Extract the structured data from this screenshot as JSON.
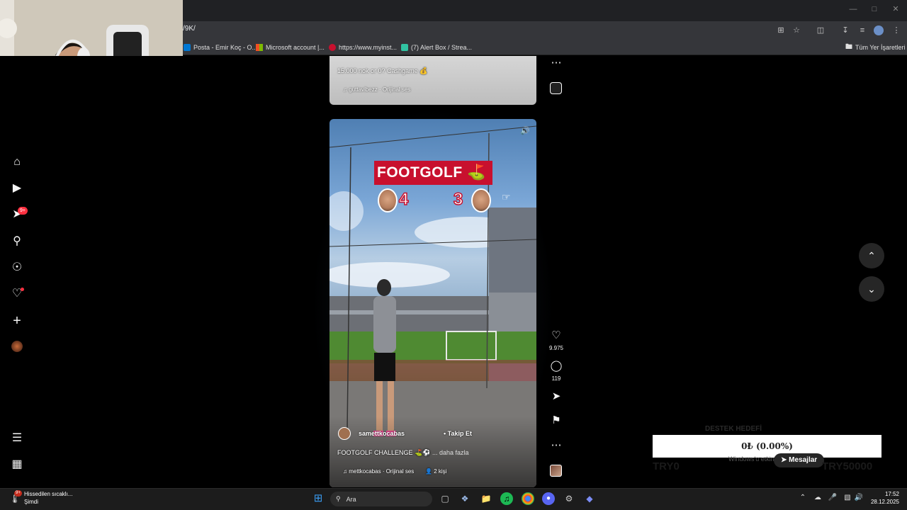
{
  "browser": {
    "url_fragment": "/9K/",
    "bookmarks": [
      {
        "label": "Posta - Emir Koç - O...",
        "color": "#0078d4"
      },
      {
        "label": "Microsoft account |...",
        "color": "#f25022"
      },
      {
        "label": "https://www.myinst...",
        "color": "#c8102e"
      },
      {
        "label": "(7) Alert Box / Strea...",
        "color": "#31c3a2"
      }
    ],
    "all_bookmarks_label": "Tüm Yer İşaretleri"
  },
  "nav": {
    "notifications_badge": "9+"
  },
  "prev_reel": {
    "caption": "15.000 nok or 0? Cashgame 💰",
    "audio": "guttavibezz · Orijinal ses"
  },
  "reel": {
    "banner": "FOOTGOLF ⛳",
    "score_left": "4",
    "score_right": "3",
    "username": "samettkocabas",
    "follow_label": "• Takip Et",
    "caption": "FOOTGOLF CHALLENGE ⛳⚽",
    "more_label": "... daha fazla",
    "audio": "mettkocabas · Orijinal ses",
    "people": "2 kişi",
    "likes": "9.975",
    "comments": "119"
  },
  "overlay": {
    "donation_title": "DESTEK HEDEFİ",
    "donation_value": "0₺ (0.00%)",
    "min": "TRY0",
    "max": "TRY50000",
    "windows_notice": "Windows'u etkinleştir",
    "messages_label": "Mesajlar"
  },
  "taskbar": {
    "weather_badge": "9+",
    "weather_title": "Hissedilen sıcaklı...",
    "weather_sub": "Şimdi",
    "search_placeholder": "Ara",
    "time": "17:52",
    "date": "28.12.2025"
  },
  "colors": {
    "accent_red": "#ff3040",
    "banner_red": "#c8102e"
  }
}
